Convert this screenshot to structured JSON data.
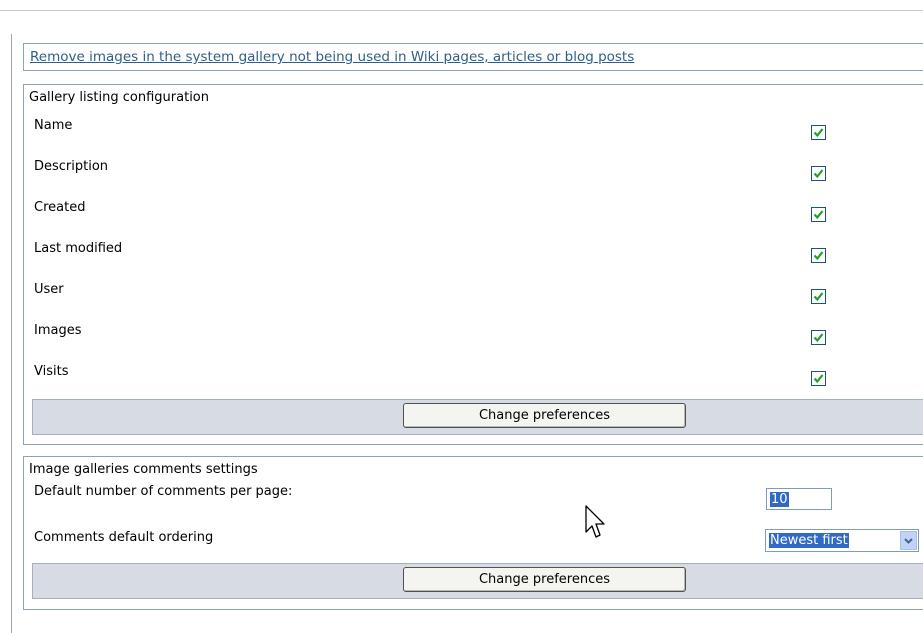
{
  "cleanup_link": "Remove images in the system gallery not being used in Wiki pages, articles or blog posts",
  "listing": {
    "legend": "Gallery listing configuration",
    "items": [
      {
        "label": "Name",
        "checked": true
      },
      {
        "label": "Description",
        "checked": true
      },
      {
        "label": "Created",
        "checked": true
      },
      {
        "label": "Last modified",
        "checked": true
      },
      {
        "label": "User",
        "checked": true
      },
      {
        "label": "Images",
        "checked": true
      },
      {
        "label": "Visits",
        "checked": true
      }
    ],
    "button_label": "Change preferences"
  },
  "comments": {
    "legend": "Image galleries comments settings",
    "per_page_label": "Default number of comments per page:",
    "per_page_value": "10",
    "ordering_label": "Comments default ordering",
    "ordering_value": "Newest first",
    "button_label": "Change preferences"
  },
  "colors": {
    "check_mark": "#21a121",
    "selection": "#316ac5",
    "link": "#2e5f8a",
    "button_bar": "#d7dce4"
  }
}
